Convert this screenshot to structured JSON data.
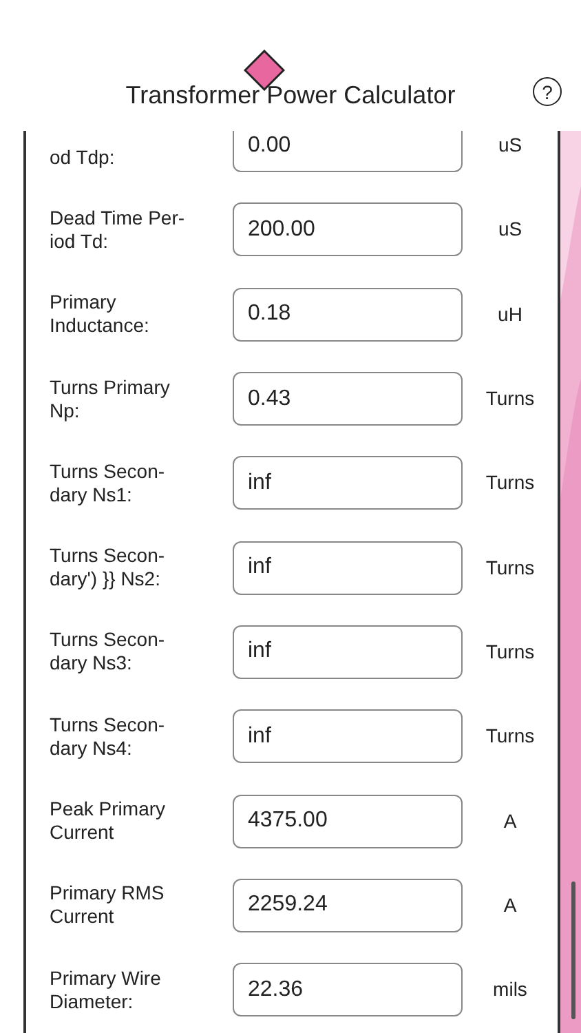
{
  "header": {
    "title": "Transformer Power Calculator",
    "help": "?"
  },
  "rows": [
    {
      "label": "od Tdp:",
      "value": "0.00",
      "unit": "uS"
    },
    {
      "label": "Dead Time Per-\niod Td:",
      "value": "200.00",
      "unit": "uS"
    },
    {
      "label": "Primary\nInductance:",
      "value": "0.18",
      "unit": "uH"
    },
    {
      "label": "Turns Primary\nNp:",
      "value": "0.43",
      "unit": "Turns"
    },
    {
      "label": "Turns Secon-\ndary Ns1:",
      "value": "inf",
      "unit": "Turns"
    },
    {
      "label": "Turns Secon-\ndary') }} Ns2:",
      "value": "inf",
      "unit": "Turns"
    },
    {
      "label": "Turns Secon-\ndary Ns3:",
      "value": "inf",
      "unit": "Turns"
    },
    {
      "label": "Turns Secon-\ndary Ns4:",
      "value": "inf",
      "unit": "Turns"
    },
    {
      "label": "Peak Primary\nCurrent",
      "value": "4375.00",
      "unit": "A"
    },
    {
      "label": "Primary RMS\nCurrent",
      "value": "2259.24",
      "unit": "A"
    },
    {
      "label": "Primary Wire\nDiameter:",
      "value": "22.36",
      "unit": "mils"
    }
  ]
}
